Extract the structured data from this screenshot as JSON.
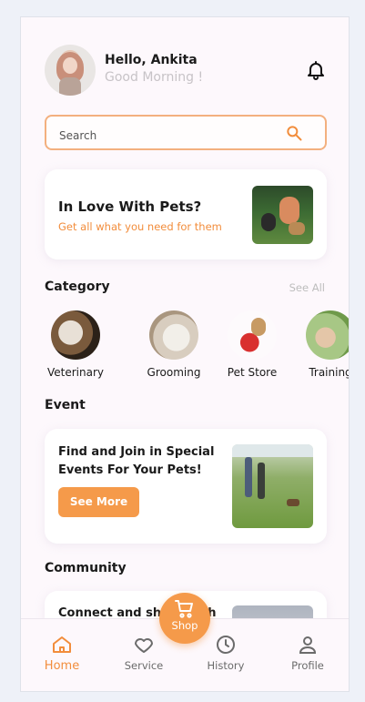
{
  "header": {
    "greeting": "Hello, Ankita",
    "subgreeting": "Good Morning !"
  },
  "search": {
    "placeholder": "Search"
  },
  "promo": {
    "title": "In Love With Pets?",
    "subtitle": "Get all what you need for them"
  },
  "category": {
    "title": "Category",
    "see_all": "See All",
    "items": [
      {
        "label": "Veterinary"
      },
      {
        "label": "Grooming"
      },
      {
        "label": "Pet Store"
      },
      {
        "label": "Training"
      }
    ]
  },
  "event": {
    "title": "Event",
    "card_title": "Find and Join in Special Events For Your Pets!",
    "button": "See More"
  },
  "community": {
    "title": "Community",
    "card_title": "Connect and share with"
  },
  "bottom_nav": {
    "home": "Home",
    "service": "Service",
    "shop": "Shop",
    "history": "History",
    "profile": "Profile"
  },
  "colors": {
    "accent": "#f59a4a",
    "accent_text": "#f28d3c"
  }
}
